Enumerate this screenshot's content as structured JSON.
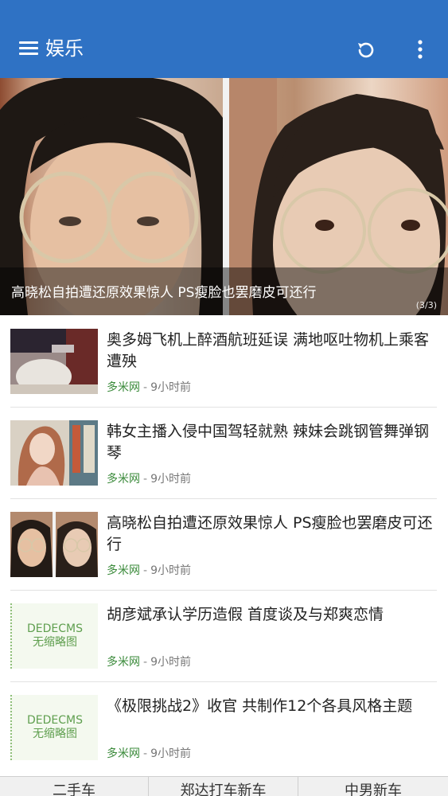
{
  "app": {
    "title": "娱乐"
  },
  "icons": {
    "menu": "menu-icon",
    "refresh": "refresh-icon",
    "more": "more-vertical-icon"
  },
  "colors": {
    "appbar": "#2f72c4",
    "source": "#3a8a3a"
  },
  "hero": {
    "caption": "高晓松自拍遭还原效果惊人 PS瘦脸也罢磨皮可还行",
    "indicator": "(3/3)"
  },
  "news": [
    {
      "title": "奥多姆飞机上醉酒航班延误 满地呕吐物机上乘客遭殃",
      "source": "多米网",
      "sep": "-",
      "time": "9小时前"
    },
    {
      "title": "韩女主播入侵中国驾轻就熟 辣妹会跳钢管舞弹钢琴",
      "source": "多米网",
      "sep": "-",
      "time": "9小时前"
    },
    {
      "title": "高晓松自拍遭还原效果惊人 PS瘦脸也罢磨皮可还行",
      "source": "多米网",
      "sep": "-",
      "time": "9小时前"
    },
    {
      "title": "胡彦斌承认学历造假 首度谈及与郑爽恋情",
      "source": "多米网",
      "sep": "-",
      "time": "9小时前",
      "thumb_line1": "DEDECMS",
      "thumb_line2": "无缩略图"
    },
    {
      "title": "《极限挑战2》收官 共制作12个各具风格主题",
      "source": "多米网",
      "sep": "-",
      "time": "9小时前",
      "thumb_line1": "DEDECMS",
      "thumb_line2": "无缩略图"
    }
  ],
  "bottom_tabs": [
    "二手车",
    "郑达打车新车",
    "中男新车"
  ]
}
